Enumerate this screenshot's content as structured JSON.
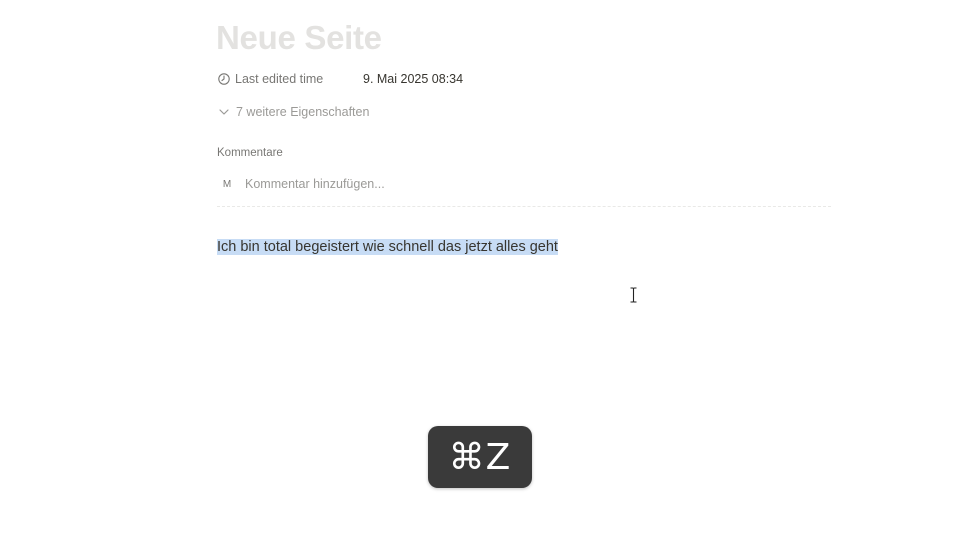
{
  "page": {
    "title": "Neue Seite"
  },
  "properties": [
    {
      "icon": "clock-icon",
      "name": "Last edited time",
      "value": "9. Mai 2025 08:34"
    }
  ],
  "more_properties": {
    "icon": "chevron-down-icon",
    "label": "7 weitere Eigenschaften"
  },
  "comments": {
    "label": "Kommentare",
    "avatar_initial": "M",
    "placeholder": "Kommentar hinzufügen..."
  },
  "content": {
    "paragraph": "Ich bin total begeistert wie schnell das jetzt alles geht",
    "selected": true
  },
  "keystroke_overlay": {
    "keys": "⌘Z"
  },
  "colors": {
    "selection": "#c7dcf5",
    "title_placeholder": "#e3e2e0",
    "overlay_bg": "#3a3a3a"
  }
}
